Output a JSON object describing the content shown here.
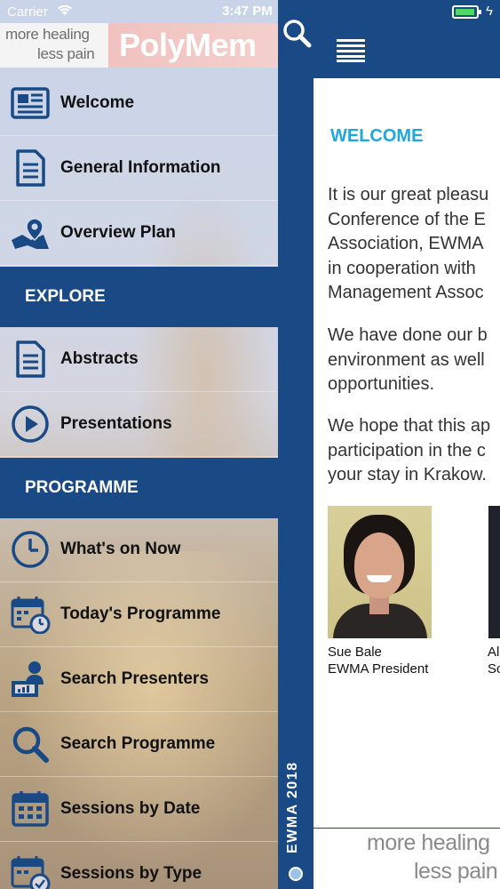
{
  "status_bar": {
    "carrier": "Carrier",
    "time": "3:47 PM"
  },
  "drawer": {
    "banner": {
      "tagline_line1": "more healing",
      "tagline_line2": "less pain",
      "brand": "PolyMem"
    },
    "top_items": [
      {
        "label": "Welcome",
        "icon": "newspaper-icon"
      },
      {
        "label": "General Information",
        "icon": "document-icon"
      },
      {
        "label": "Overview Plan",
        "icon": "map-pin-icon"
      }
    ],
    "explore": {
      "heading": "EXPLORE",
      "items": [
        {
          "label": "Abstracts",
          "icon": "document-icon"
        },
        {
          "label": "Presentations",
          "icon": "play-circle-icon"
        }
      ]
    },
    "programme": {
      "heading": "PROGRAMME",
      "items": [
        {
          "label": "What's on Now",
          "icon": "clock-icon"
        },
        {
          "label": "Today's Programme",
          "icon": "calendar-clock-icon"
        },
        {
          "label": "Search Presenters",
          "icon": "presenter-icon"
        },
        {
          "label": "Search Programme",
          "icon": "search-icon"
        },
        {
          "label": "Sessions by Date",
          "icon": "calendar-icon"
        },
        {
          "label": "Sessions by Type",
          "icon": "calendar-check-icon"
        }
      ]
    },
    "side_label": "EWMA 2018"
  },
  "main": {
    "heading": "WELCOME",
    "paragraphs": [
      [
        "It is our great pleasu",
        "Conference of the E",
        "Association, EWMA",
        "in cooperation with",
        "Management Assoc"
      ],
      [
        "We have done our b",
        "environment as well",
        "opportunities."
      ],
      [
        "We hope that this ap",
        "participation in the c",
        "your stay in Krakow."
      ]
    ],
    "people": [
      {
        "name": "Sue Bale",
        "role": "EWMA President"
      },
      {
        "name": "Al",
        "role": "Sc"
      }
    ],
    "footer": {
      "tagline_line1": "more healing",
      "tagline_line2": "less pain"
    }
  },
  "colors": {
    "brand_blue": "#1a4a86",
    "heading_cyan": "#1ea7dc",
    "battery_green": "#4cd964"
  }
}
